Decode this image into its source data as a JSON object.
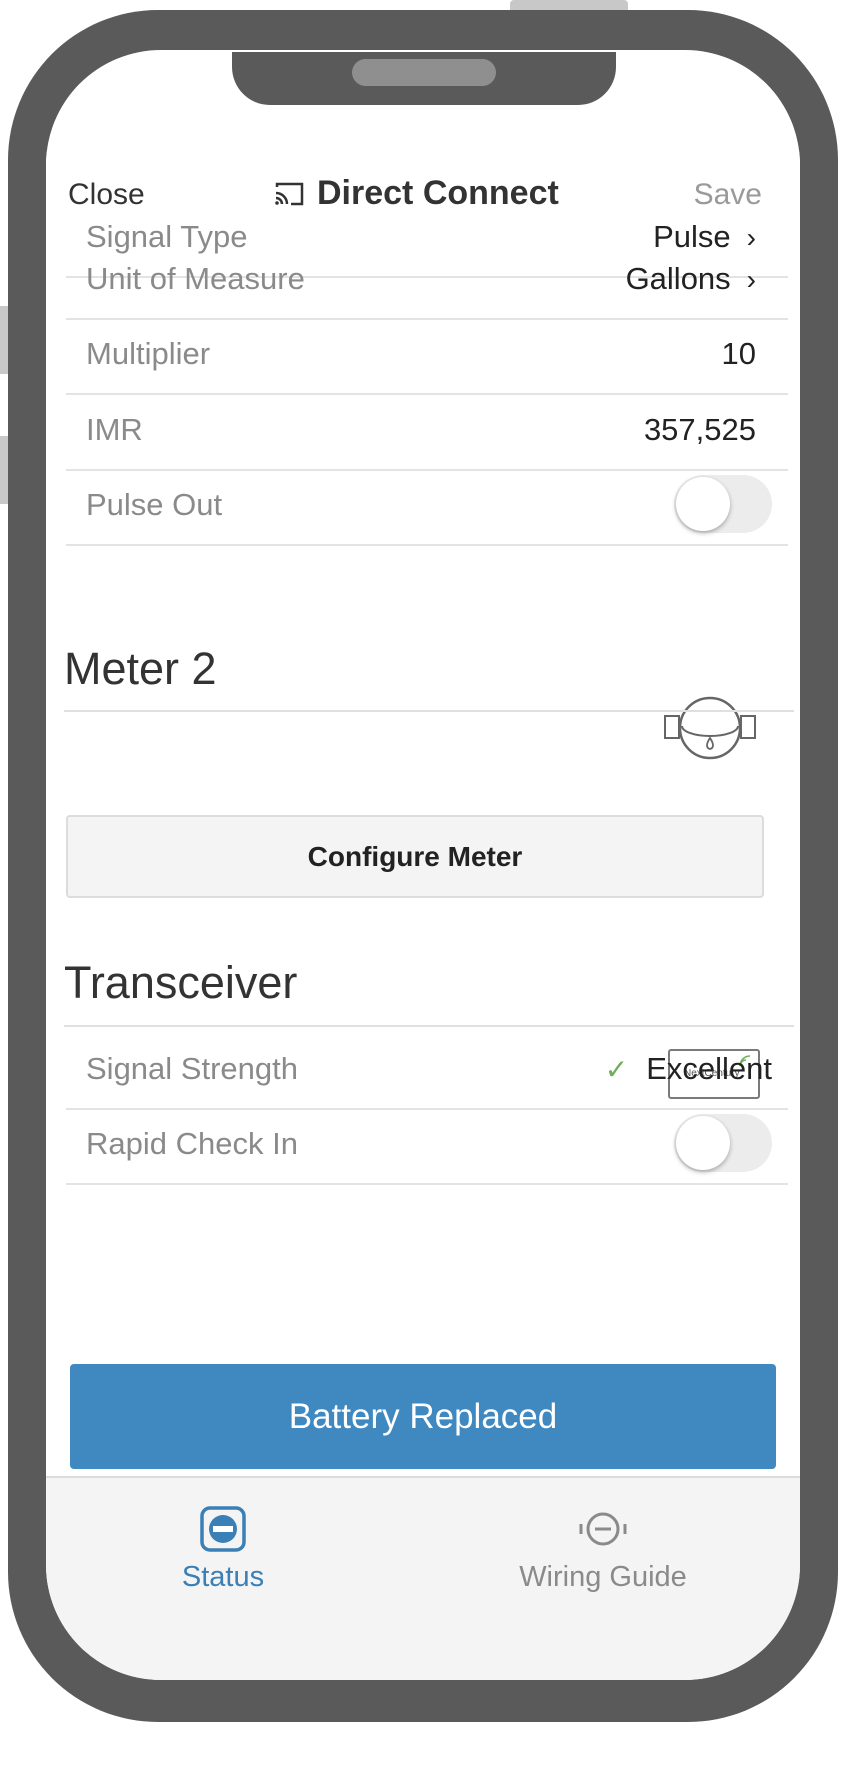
{
  "navbar": {
    "close_label": "Close",
    "title": "Direct Connect",
    "title_icon": "cast-icon",
    "save_label": "Save"
  },
  "meter1": {
    "rows": [
      {
        "label": "Signal Type",
        "value": "Pulse"
      },
      {
        "label": "Unit of Measure",
        "value": "Gallons"
      },
      {
        "label": "Multiplier",
        "value": "10"
      },
      {
        "label": "IMR",
        "value": "357,525"
      },
      {
        "label": "Pulse Out",
        "toggle": false
      }
    ]
  },
  "meter2": {
    "title": "Meter 2",
    "icon": "water-meter-icon",
    "configure_label": "Configure Meter"
  },
  "transceiver": {
    "title": "Transceiver",
    "brand_logo": "NextCentury",
    "rows": [
      {
        "label": "Signal Strength",
        "value": "Excellent",
        "status_icon": "checkmark-icon"
      },
      {
        "label": "Rapid Check In",
        "toggle": false
      }
    ]
  },
  "battery_button_label": "Battery Replaced",
  "tabs": [
    {
      "label": "Status",
      "icon": "status-icon",
      "active": true
    },
    {
      "label": "Wiring Guide",
      "icon": "wiring-guide-icon",
      "active": false
    }
  ],
  "colors": {
    "accent": "#3f89c0",
    "active_tab": "#3a7fb5",
    "check": "#6fae5c",
    "frame": "#5a5a5a"
  }
}
